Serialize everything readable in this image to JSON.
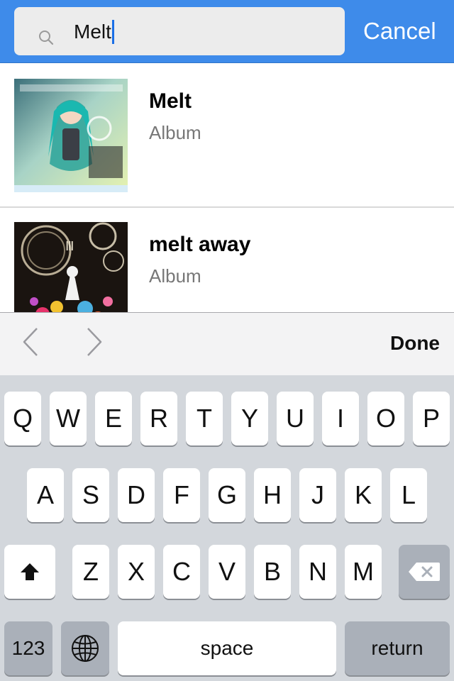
{
  "search": {
    "value": "Melt",
    "cancel_label": "Cancel"
  },
  "results": [
    {
      "title": "Melt",
      "subtitle": "Album",
      "art": "hatsune-miku-cover-art"
    },
    {
      "title": "melt away",
      "subtitle": "Album",
      "art": "clock-gears-flowers-cover-art"
    }
  ],
  "accessory": {
    "prev_icon": "chevron-left-icon",
    "next_icon": "chevron-right-icon",
    "done_label": "Done"
  },
  "keyboard": {
    "row1": [
      "Q",
      "W",
      "E",
      "R",
      "T",
      "Y",
      "U",
      "I",
      "O",
      "P"
    ],
    "row2": [
      "A",
      "S",
      "D",
      "F",
      "G",
      "H",
      "J",
      "K",
      "L"
    ],
    "row3": [
      "Z",
      "X",
      "C",
      "V",
      "B",
      "N",
      "M"
    ],
    "shift_icon": "shift-arrow-icon",
    "delete_icon": "delete-backspace-icon",
    "numbers_label": "123",
    "globe_icon": "globe-icon",
    "space_label": "space",
    "return_label": "return"
  },
  "colors": {
    "header_blue": "#3e8bea",
    "caret_blue": "#1a6fe6",
    "keyboard_bg": "#d3d7dc"
  }
}
